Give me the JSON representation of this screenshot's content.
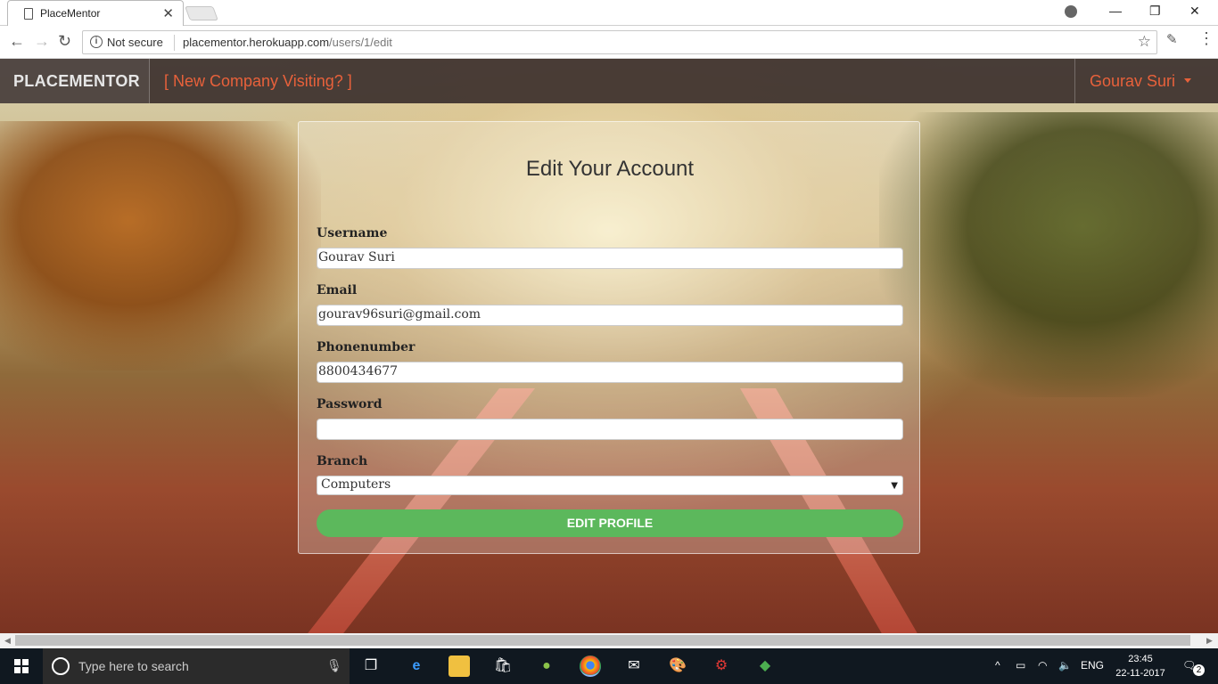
{
  "browser": {
    "tab_title": "PlaceMentor",
    "security_label": "Not secure",
    "url_host": "placementor.herokuapp.com",
    "url_path": "/users/1/edit"
  },
  "navbar": {
    "brand": "PLACEMENTOR",
    "company_link": "[ New Company Visiting? ]",
    "user_name": "Gourav Suri"
  },
  "form": {
    "title": "Edit Your Account",
    "username_label": "Username",
    "username_value": "Gourav Suri",
    "email_label": "Email",
    "email_value": "gourav96suri@gmail.com",
    "phone_label": "Phonenumber",
    "phone_value": "8800434677",
    "password_label": "Password",
    "password_value": "",
    "branch_label": "Branch",
    "branch_value": "Computers",
    "submit_label": "EDIT PROFILE"
  },
  "taskbar": {
    "search_placeholder": "Type here to search",
    "language": "ENG",
    "time": "23:45",
    "date": "22-11-2017",
    "notification_count": "2"
  },
  "colors": {
    "accent": "#e8613b",
    "submit": "#5cb85c",
    "navbar": "#3c302c"
  }
}
